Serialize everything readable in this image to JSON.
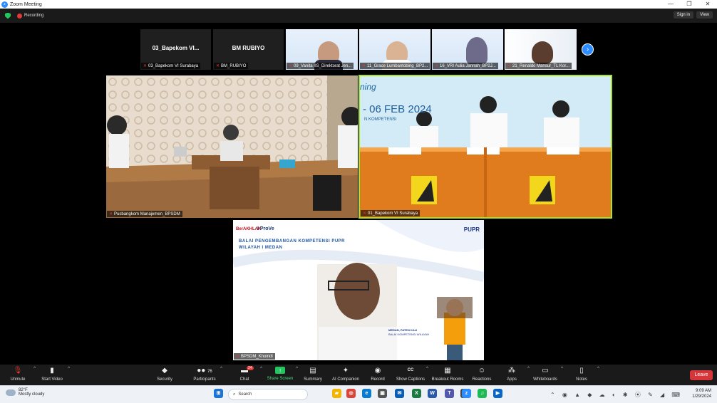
{
  "window": {
    "title": "Zoom Meeting",
    "minimize": "—",
    "maximize": "❐",
    "close": "✕"
  },
  "topbar": {
    "recording": "Recording",
    "sign_in": "Sign in",
    "view": "View"
  },
  "strip": [
    {
      "center": "03_Bapekom VI...",
      "name": "03_Bapekom VI Surabaya"
    },
    {
      "center": "BM RUBIYO",
      "name": "BM_RUBIYO"
    },
    {
      "name": "09_Vanita IIS_Direktorat Jen..."
    },
    {
      "name": "11_Grace Lumbantobing_BP2..."
    },
    {
      "name": "16_VRI Aulia Jannah_BP2J..."
    },
    {
      "name": "21_Renaldo Mansur_TL Kor..."
    }
  ],
  "main_left": {
    "name": "Pusbangkom Manajemen_BPSDM"
  },
  "main_right": {
    "name": "01_Bapekom VI Surabaya",
    "banner_text": "- 06 FEB 2024",
    "banner_word": "ning",
    "banner_sub": "N KOMPETENSI"
  },
  "bottom_tile": {
    "name": "BPSDM_Khoiridl",
    "logo_left": "BerAKHLAK",
    "logo_left2": "I ProVe",
    "logo_right": "PUPR",
    "heading_line1": "BALAI PENGEMBANGAN KOMPETENSI PUPR",
    "heading_line2": "WILAYAH I MEDAN",
    "caption1": "MEDAN, PATEN KALI",
    "caption2": "BALAI KOMPETENSI WILAYAH"
  },
  "toolbar": {
    "unmute": "Unmute",
    "start_video": "Start Video",
    "security": "Security",
    "participants": "Participants",
    "participants_count": "76",
    "chat": "Chat",
    "chat_badge": "24",
    "share": "Share Screen",
    "summary": "Summary",
    "ai": "AI Companion",
    "record": "Record",
    "captions": "Show Captions",
    "breakout": "Breakout Rooms",
    "reactions": "Reactions",
    "apps": "Apps",
    "whiteboards": "Whiteboards",
    "notes": "Notes",
    "leave": "Leave"
  },
  "taskbar": {
    "temp": "82°F",
    "weather": "Mostly cloudy",
    "search_placeholder": "Search",
    "time": "9:09 AM",
    "date": "1/29/2024"
  },
  "colors": {
    "accent": "#2d8cff",
    "active_speaker": "#a6e22e",
    "leave": "#d6363a",
    "share": "#22c55e"
  }
}
